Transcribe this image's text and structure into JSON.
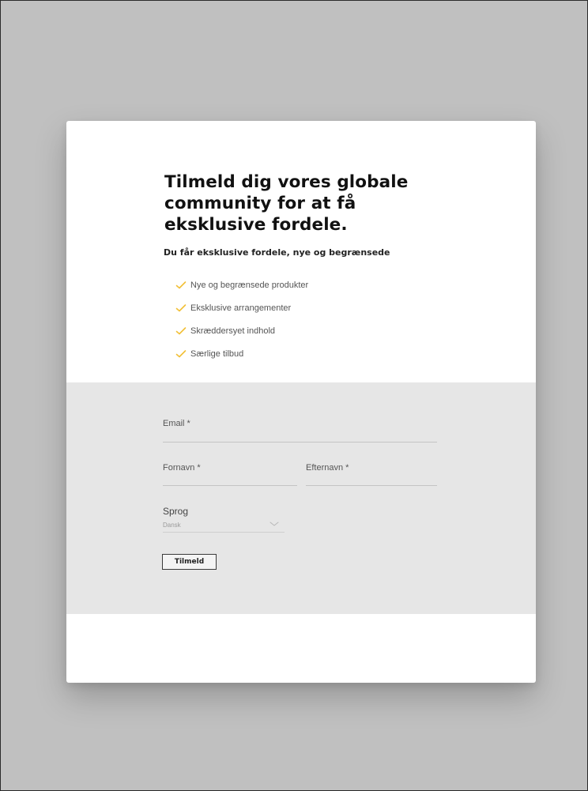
{
  "signup": {
    "headline": "Tilmeld dig vores globale community for at få eksklusive fordele.",
    "subhead": "Du får eksklusive fordele, nye og begrænsede",
    "benefits": [
      "Nye og begrænsede produkter",
      "Eksklusive arrangementer",
      "Skræddersyet indhold",
      "Særlige tilbud"
    ],
    "check_color": "#f2c037"
  },
  "form": {
    "email_label": "Email *",
    "firstname_label": "Fornavn *",
    "lastname_label": "Efternavn *",
    "language_label": "Sprog",
    "language_value": "Dansk",
    "submit_label": "Tilmeld"
  }
}
